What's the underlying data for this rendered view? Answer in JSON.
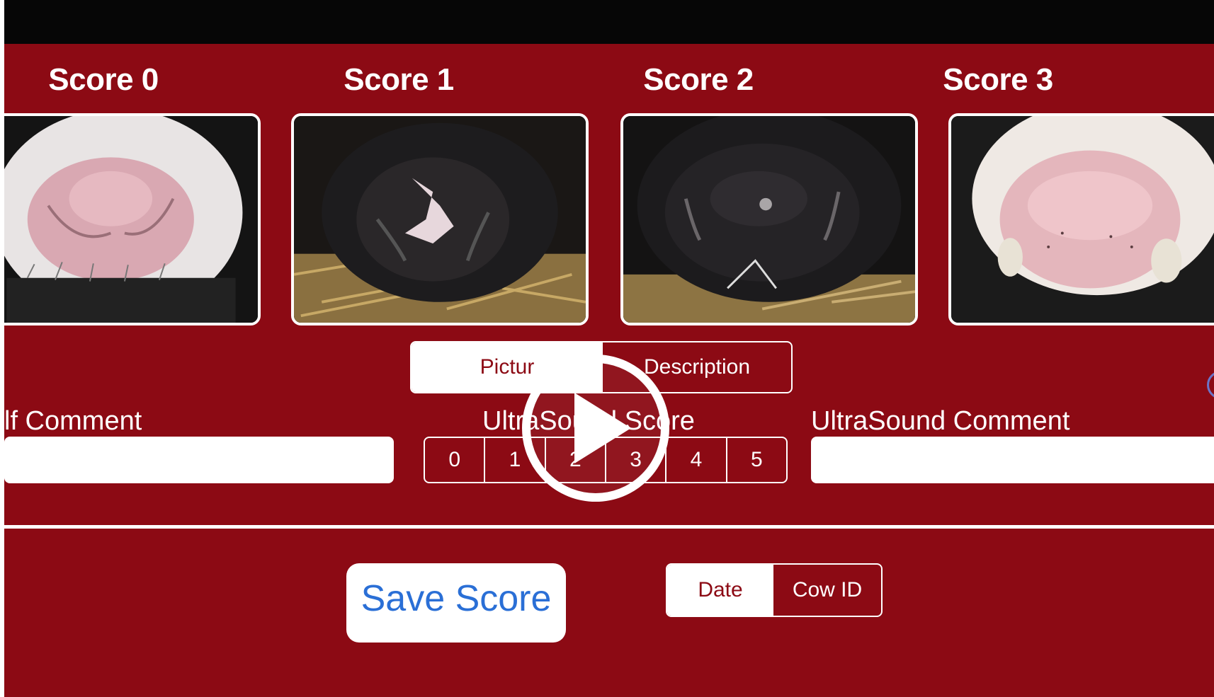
{
  "scores": [
    {
      "title": "Score 0",
      "image": "cow-muzzle-score-0"
    },
    {
      "title": "Score 1",
      "image": "cow-muzzle-score-1"
    },
    {
      "title": "Score 2",
      "image": "cow-muzzle-score-2"
    },
    {
      "title": "Score 3",
      "image": "cow-muzzle-score-3"
    }
  ],
  "view_toggle": {
    "picture_label": "Pictur",
    "description_label": "Description",
    "selected": "Picture"
  },
  "self_comment": {
    "label": "lf Comment",
    "value": ""
  },
  "ultrasound": {
    "score_label": "UltraSound Score",
    "options": [
      "0",
      "1",
      "2",
      "3",
      "4",
      "5"
    ],
    "comment_label": "UltraSound Comment",
    "comment_value": ""
  },
  "actions": {
    "save_label": "Save Score"
  },
  "sort_toggle": {
    "date_label": "Date",
    "cow_id_label": "Cow ID",
    "selected": "Date"
  },
  "overlay": {
    "icon": "play-icon"
  },
  "colors": {
    "background": "#8c0a14",
    "top_bar": "#060606",
    "accent_blue": "#2a6fd6",
    "white": "#ffffff"
  }
}
